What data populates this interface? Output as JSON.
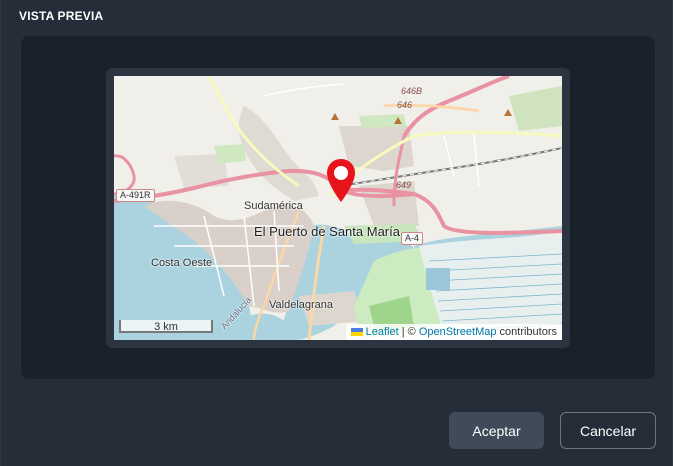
{
  "dialog": {
    "title": "VISTA PREVIA"
  },
  "map": {
    "places": {
      "city": "El Puerto de Santa María",
      "sudamerica": "Sudamérica",
      "costa_oeste": "Costa Oeste",
      "valdelagrana": "Valdelagrana",
      "andalucia": "Andalucía"
    },
    "roads": {
      "a491r": "A-491R",
      "a4": "A-4",
      "r649": "649",
      "r646": "646",
      "r646b": "646B"
    },
    "scale_label": "3 km",
    "attribution": {
      "leaflet": "Leaflet",
      "separator": " | © ",
      "osm": "OpenStreetMap",
      "suffix": " contributors"
    },
    "colors": {
      "marker": "#e8141c",
      "water": "#aad3df",
      "land": "#f1efe9",
      "urban": "#d9d0c9"
    }
  },
  "buttons": {
    "accept": "Aceptar",
    "cancel": "Cancelar"
  }
}
